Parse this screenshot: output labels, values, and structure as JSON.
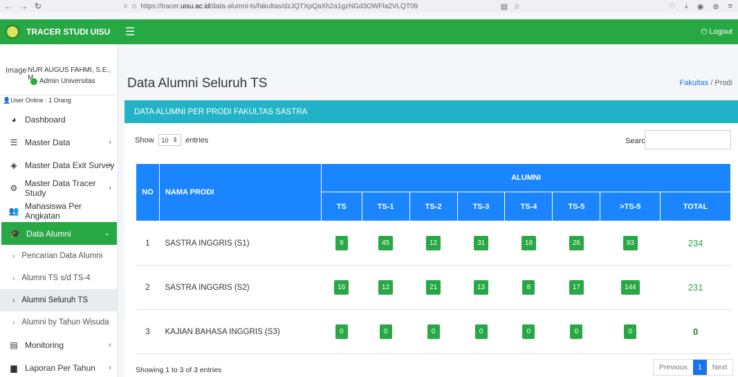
{
  "browser": {
    "url_prefix": "https://tracer.",
    "url_domain": "uisu.ac.id",
    "url_path": "/data-alumni-ts/fakultas/dzJQTXpQaXh2a1gzNGd3OWFla2VLQT09"
  },
  "brand": {
    "name": "TRACER STUDI UISU"
  },
  "topbar": {
    "logout": "Logout"
  },
  "user": {
    "image_alt": "Image",
    "name": "NUR AUGUS FAHMI, S.E., M.",
    "role": "Admin Universitas",
    "online": "User Online : 1 Orang"
  },
  "menu": [
    {
      "label": "Dashboard",
      "icon": "dashboard-icon",
      "chevron": false
    },
    {
      "label": "Master Data",
      "icon": "database-icon",
      "chevron": true
    },
    {
      "label": "Master Data Exit Survey",
      "icon": "survey-icon",
      "chevron": true
    },
    {
      "label": "Master Data Tracer Study",
      "icon": "tracer-icon",
      "chevron": true
    },
    {
      "label": "Mahasiswa Per Angkatan",
      "icon": "users-icon",
      "chevron": false
    },
    {
      "label": "Data Alumni",
      "icon": "graduation-cap-icon",
      "chevron": true
    }
  ],
  "submenu": [
    {
      "label": "Pencarian Data Alumni"
    },
    {
      "label": "Alumni TS s/d TS-4"
    },
    {
      "label": "Alumni Seluruh TS"
    },
    {
      "label": "Alumni by Tahun Wisuda"
    }
  ],
  "menu_bottom": [
    {
      "label": "Monitoring",
      "icon": "monitor-icon"
    },
    {
      "label": "Laporan Per Tahun",
      "icon": "report-icon"
    }
  ],
  "page": {
    "title": "Data Alumni Seluruh TS",
    "breadcrumb_link": "Fakultas",
    "breadcrumb_sep": "/",
    "breadcrumb_current": "Prodi"
  },
  "card": {
    "header": "DATA ALUMNI PER PRODI FAKULTAS SASTRA",
    "show_label": "Show",
    "show_value": "10",
    "entries_label": "entries",
    "search_label": "Search:"
  },
  "table": {
    "col_no": "NO",
    "col_name": "NAMA PRODI",
    "group": "ALUMNI",
    "sub_cols": [
      "TS",
      "TS-1",
      "TS-2",
      "TS-3",
      "TS-4",
      "TS-5",
      ">TS-5",
      "TOTAL"
    ],
    "rows": [
      {
        "no": "1",
        "name": "SASTRA INGGRIS (S1)",
        "values": [
          "9",
          "45",
          "12",
          "31",
          "18",
          "26",
          "93"
        ],
        "total": "234"
      },
      {
        "no": "2",
        "name": "SASTRA INGGRIS (S2)",
        "values": [
          "16",
          "12",
          "21",
          "13",
          "8",
          "17",
          "144"
        ],
        "total": "231"
      },
      {
        "no": "3",
        "name": "KAJIAN BAHASA INGGRIS (S3)",
        "values": [
          "0",
          "0",
          "0",
          "0",
          "0",
          "0",
          "0"
        ],
        "total": "0"
      }
    ]
  },
  "footer": {
    "info": "Showing 1 to 3 of 3 entries",
    "prev": "Previous",
    "page": "1",
    "next": "Next"
  }
}
